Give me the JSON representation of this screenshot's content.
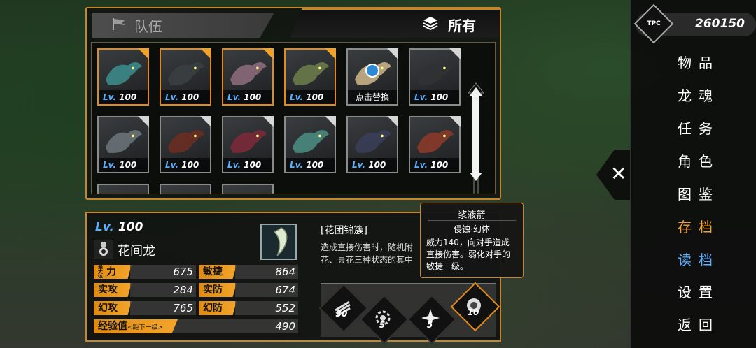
{
  "tabs": {
    "team": "队伍",
    "all": "所有"
  },
  "cards": [
    {
      "level_prefix": "Lv.",
      "level": "100",
      "selected": true,
      "color": "#3b8a88"
    },
    {
      "level_prefix": "Lv.",
      "level": "100",
      "selected": true,
      "color": "#3a3f40"
    },
    {
      "level_prefix": "Lv.",
      "level": "100",
      "selected": true,
      "color": "#8a6a7a"
    },
    {
      "level_prefix": "Lv.",
      "level": "100",
      "selected": true,
      "color": "#6a7a4a"
    },
    {
      "swap": "点击替换",
      "selected": false,
      "color": "#c8b088"
    },
    {
      "level_prefix": "Lv.",
      "level": "100",
      "selected": false,
      "color": "#303234"
    },
    {
      "level_prefix": "Lv.",
      "level": "100",
      "selected": false,
      "color": "#6a7278"
    },
    {
      "level_prefix": "Lv.",
      "level": "100",
      "selected": false,
      "color": "#6a2e22"
    },
    {
      "level_prefix": "Lv.",
      "level": "100",
      "selected": false,
      "color": "#7a2a3a"
    },
    {
      "level_prefix": "Lv.",
      "level": "100",
      "selected": false,
      "color": "#4a8a80"
    },
    {
      "level_prefix": "Lv.",
      "level": "100",
      "selected": false,
      "color": "#3a3e58"
    },
    {
      "level_prefix": "Lv.",
      "level": "100",
      "selected": false,
      "color": "#8a3a2a"
    }
  ],
  "dragon": {
    "level_prefix": "Lv.",
    "level": "100",
    "name": "花间龙",
    "stats": [
      {
        "label": "力",
        "label_small": "最大体",
        "value": "675"
      },
      {
        "label": "敏捷",
        "value": "864"
      },
      {
        "label": "实攻",
        "value": "284"
      },
      {
        "label": "实防",
        "value": "674"
      },
      {
        "label": "幻攻",
        "value": "765"
      },
      {
        "label": "幻防",
        "value": "552"
      }
    ],
    "exp_label": "经验值",
    "exp_note": "<距下一级>",
    "exp_value": "490"
  },
  "skill": {
    "title": "[花团锦簇]",
    "desc": "造成直接伤害时，随机附\n花、昙花三种状态的其中",
    "slots": [
      {
        "count": "30",
        "selected": false
      },
      {
        "count": "5",
        "selected": false
      },
      {
        "count": "5",
        "selected": false
      },
      {
        "count": "10",
        "selected": true
      }
    ]
  },
  "tooltip": {
    "name": "浆液箭",
    "type": "侵蚀·幻体",
    "desc": "威力140，向对手造成直接伤害。弱化对手的敏捷一级。"
  },
  "currency": {
    "icon_text": "TPC",
    "value": "260150"
  },
  "menu": [
    {
      "label": "物品",
      "color": "white"
    },
    {
      "label": "龙魂",
      "color": "white"
    },
    {
      "label": "任务",
      "color": "white"
    },
    {
      "label": "角色",
      "color": "white"
    },
    {
      "label": "图鉴",
      "color": "white"
    },
    {
      "label": "存档",
      "color": "orange"
    },
    {
      "label": "读档",
      "color": "blue"
    },
    {
      "label": "设置",
      "color": "white"
    },
    {
      "label": "返回",
      "color": "white"
    }
  ],
  "accent_color": "#c8862a"
}
